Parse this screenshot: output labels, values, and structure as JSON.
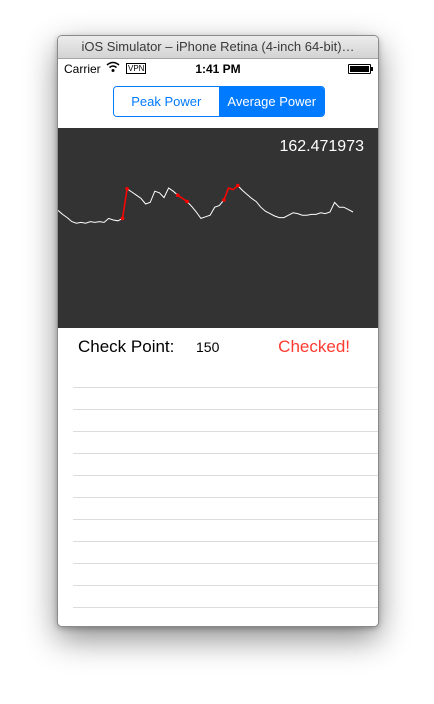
{
  "window": {
    "title": "iOS Simulator – iPhone Retina (4-inch 64-bit)…"
  },
  "status_bar": {
    "carrier": "Carrier",
    "vpn": "VPN",
    "time": "1:41 PM"
  },
  "segmented_control": {
    "options": [
      "Peak Power",
      "Average Power"
    ],
    "selected": "Average Power"
  },
  "chart": {
    "value_readout": "162.471973",
    "background_color": "#333333",
    "line_color": "#ffffff",
    "highlight_color": "#ff0000"
  },
  "check_point": {
    "label": "Check Point:",
    "value": "150",
    "status": "Checked!",
    "status_color": "#ff3b30"
  },
  "list": {
    "row_count": 11
  },
  "colors": {
    "accent": "#007aff"
  },
  "chart_data": {
    "type": "line",
    "series": [
      {
        "values": [
          72,
          67,
          63,
          58,
          56,
          57,
          56,
          58,
          57,
          58,
          57,
          62,
          60,
          59,
          62,
          99,
          95,
          91,
          87,
          80,
          82,
          96,
          94,
          88,
          100,
          96,
          91,
          87,
          83,
          77,
          70,
          62,
          64,
          66,
          76,
          78,
          85,
          100,
          98,
          103,
          97,
          92,
          87,
          83,
          76,
          71,
          68,
          65,
          63,
          63,
          66,
          69,
          68,
          66,
          66,
          67,
          67,
          69,
          68,
          70,
          82,
          76,
          76,
          73,
          70
        ],
        "highlight_segments": [
          [
            14,
            15
          ],
          [
            26,
            28
          ],
          [
            36,
            39
          ]
        ]
      }
    ]
  }
}
